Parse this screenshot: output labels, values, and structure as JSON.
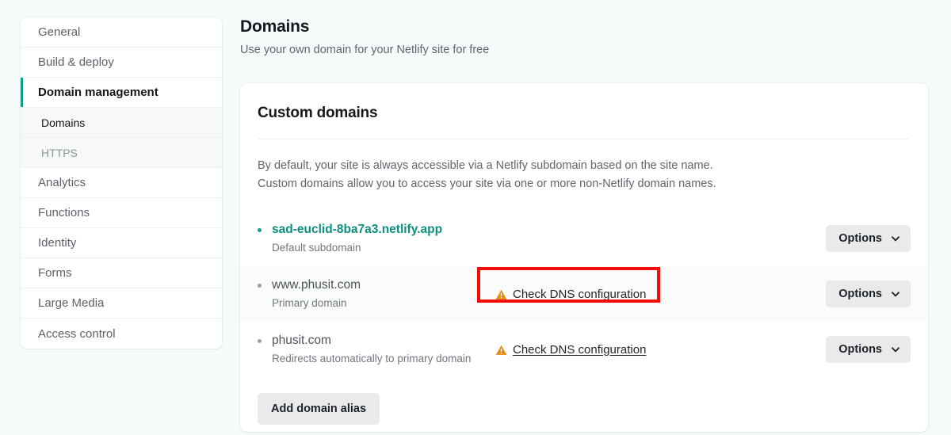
{
  "sidebar": {
    "items": [
      {
        "label": "General",
        "type": "item",
        "state": "default"
      },
      {
        "label": "Build & deploy",
        "type": "item",
        "state": "default"
      },
      {
        "label": "Domain management",
        "type": "item",
        "state": "active"
      },
      {
        "label": "Domains",
        "type": "sub",
        "state": "current"
      },
      {
        "label": "HTTPS",
        "type": "sub",
        "state": "default"
      },
      {
        "label": "Analytics",
        "type": "item",
        "state": "default"
      },
      {
        "label": "Functions",
        "type": "item",
        "state": "default"
      },
      {
        "label": "Identity",
        "type": "item",
        "state": "default"
      },
      {
        "label": "Forms",
        "type": "item",
        "state": "default"
      },
      {
        "label": "Large Media",
        "type": "item",
        "state": "default"
      },
      {
        "label": "Access control",
        "type": "item",
        "state": "default"
      }
    ]
  },
  "header": {
    "title": "Domains",
    "subtitle": "Use your own domain for your Netlify site for free"
  },
  "card": {
    "title": "Custom domains",
    "description_line_1": "By default, your site is always accessible via a Netlify subdomain based on the site name.",
    "description_line_2": "Custom domains allow you to access your site via one or more non-Netlify domain names.",
    "add_alias_label": "Add domain alias",
    "options_label": "Options",
    "dns_link_label": "Check DNS configuration",
    "rows": [
      {
        "domain": "sad-euclid-8ba7a3.netlify.app",
        "note": "Default subdomain",
        "is_link": true,
        "bullet": "teal",
        "has_dns_warning": false,
        "highlighted": false
      },
      {
        "domain": "www.phusit.com",
        "note": "Primary domain",
        "is_link": false,
        "bullet": "gray",
        "has_dns_warning": true,
        "highlighted": true
      },
      {
        "domain": "phusit.com",
        "note": "Redirects automatically to primary domain",
        "is_link": false,
        "bullet": "gray",
        "has_dns_warning": true,
        "highlighted": false
      }
    ]
  },
  "icons": {
    "warning": "warning-triangle-icon",
    "chevron": "chevron-down-icon"
  },
  "colors": {
    "page_background": "#f4fbfa",
    "accent_teal": "#0e9f89",
    "link_teal": "#0e8f7e",
    "warning_amber": "#e8890c",
    "annotation_red": "#f20d0d",
    "button_gray": "#e8eaec"
  }
}
